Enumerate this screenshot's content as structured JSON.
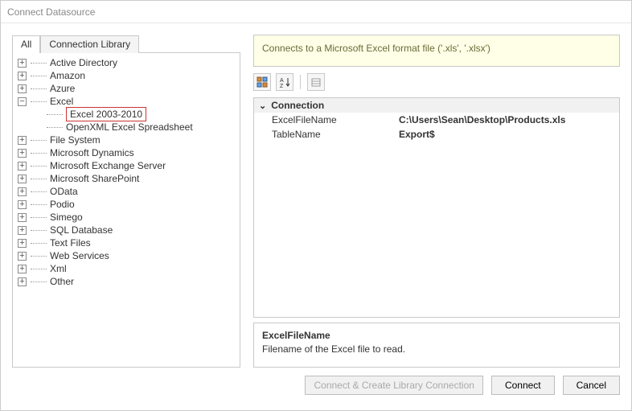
{
  "title": "Connect Datasource",
  "tabs": {
    "all": "All",
    "library": "Connection Library"
  },
  "tree": {
    "items": [
      {
        "label": "Active Directory"
      },
      {
        "label": "Amazon"
      },
      {
        "label": "Azure"
      },
      {
        "label": "Excel",
        "expanded": true,
        "children": [
          {
            "label": "Excel 2003-2010",
            "highlight": true
          },
          {
            "label": "OpenXML Excel Spreadsheet"
          }
        ]
      },
      {
        "label": "File System"
      },
      {
        "label": "Microsoft Dynamics"
      },
      {
        "label": "Microsoft Exchange Server"
      },
      {
        "label": "Microsoft SharePoint"
      },
      {
        "label": "OData"
      },
      {
        "label": "Podio"
      },
      {
        "label": "Simego"
      },
      {
        "label": "SQL Database"
      },
      {
        "label": "Text Files"
      },
      {
        "label": "Web Services"
      },
      {
        "label": "Xml"
      },
      {
        "label": "Other"
      }
    ]
  },
  "info_text": "Connects to a Microsoft Excel format file ('.xls', '.xlsx')",
  "props": {
    "group": "Connection",
    "rows": [
      {
        "name": "ExcelFileName",
        "value": "C:\\Users\\Sean\\Desktop\\Products.xls"
      },
      {
        "name": "TableName",
        "value": "Export$"
      }
    ]
  },
  "desc": {
    "title": "ExcelFileName",
    "text": "Filename of the Excel file to read."
  },
  "buttons": {
    "connect_create": "Connect & Create Library Connection",
    "connect": "Connect",
    "cancel": "Cancel"
  }
}
